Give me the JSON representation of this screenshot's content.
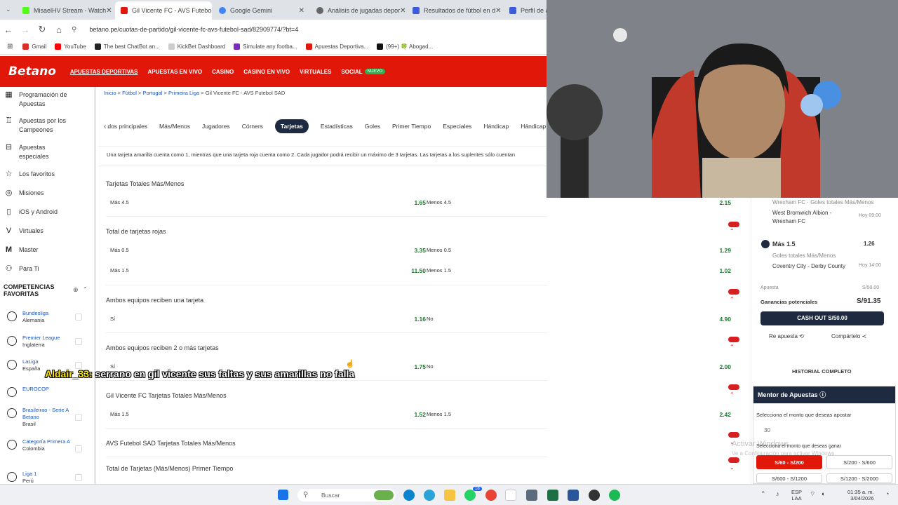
{
  "browser": {
    "tabs": [
      {
        "title": "MisaelHV Stream - Watch",
        "color": "#53fc18"
      },
      {
        "title": "Gil Vicente FC - AVS Futebol",
        "color": "#e1170a",
        "active": true
      },
      {
        "title": "Google Gemini",
        "color": "#4285f4"
      },
      {
        "title": "Análisis de jugadas depor",
        "color": "#666666"
      },
      {
        "title": "Resultados de fútbol en d",
        "color": "#3b5bdb"
      },
      {
        "title": "Perfil de a",
        "color": "#3b5bdb"
      }
    ],
    "url": "betano.pe/cuotas-de-partido/gil-vicente-fc-avs-futebol-sad/82909774/?bt=4",
    "bookmarks": [
      "Gmail",
      "YouTube",
      "The best ChatBot an...",
      "KickBet Dashboard",
      "Simulate any footba...",
      "Apuestas Deportiva...",
      "(99+) 🍀 Abogad..."
    ]
  },
  "header": {
    "logo": "Betano",
    "nav": [
      "APUESTAS DEPORTIVAS",
      "APUESTAS EN VIVO",
      "CASINO",
      "CASINO EN VIVO",
      "VIRTUALES",
      "SOCIAL"
    ],
    "social_badge": "NUEVO"
  },
  "sidebar": {
    "items": [
      {
        "label": "Programación de Apuestas",
        "icon": "calendar-icon"
      },
      {
        "label": "Apuestas por los Campeones",
        "icon": "trophy-icon"
      },
      {
        "label": "Apuestas especiales",
        "icon": "ticket-icon"
      },
      {
        "label": "Los favoritos",
        "icon": "star-icon"
      },
      {
        "label": "Misiones",
        "icon": "target-icon"
      },
      {
        "label": "iOS y Android",
        "icon": "phone-icon"
      },
      {
        "label": "Virtuales",
        "icon": "virtual-icon"
      },
      {
        "label": "Master",
        "icon": "master-icon"
      },
      {
        "label": "Para Ti",
        "icon": "user-icon"
      }
    ],
    "favorites_title": "COMPETENCIAS FAVORITAS",
    "competitions": [
      {
        "name": "Bundesliga",
        "country": "Alemania"
      },
      {
        "name": "Premier League",
        "country": "Inglaterra"
      },
      {
        "name": "LaLiga",
        "country": "España"
      },
      {
        "name": "EUROCOP",
        "country": ""
      },
      {
        "name": "Brasileirao - Serie A Betano",
        "country": "Brasil"
      },
      {
        "name": "Categoría Primera A",
        "country": "Colombia"
      },
      {
        "name": "Liga 1",
        "country": "Perú"
      }
    ]
  },
  "main": {
    "breadcrumbs": [
      "Inicio",
      "Fútbol",
      "Portugal",
      "Primeira Liga",
      "Gil Vicente FC - AVS Futebol SAD"
    ],
    "tabs": [
      "dos principales",
      "Más/Menos",
      "Jugadores",
      "Córners",
      "Tarjetas",
      "Estadísticas",
      "Goles",
      "Primer Tiempo",
      "Especiales",
      "Hándicap",
      "Hándicap Asiá"
    ],
    "active_tab": "Tarjetas",
    "info": "Una tarjeta amarilla cuenta como 1, mientras que una tarjeta roja cuenta como 2. Cada jugador podrá recibir un máximo de 3 tarjetas. Las tarjetas a los suplentes sólo cuentan",
    "markets": [
      {
        "title": "Tarjetas Totales Más/Menos",
        "rows": [
          {
            "l": "Más 4.5",
            "o": "1.65",
            "l2": "Menos 4.5",
            "o2": "2.15"
          }
        ]
      },
      {
        "title": "Total de tarjetas rojas",
        "rows": [
          {
            "l": "Más 0.5",
            "o": "3.35",
            "l2": "Menos 0.5",
            "o2": "1.29"
          },
          {
            "l": "Más 1.5",
            "o": "11.50",
            "l2": "Menos 1.5",
            "o2": "1.02"
          }
        ]
      },
      {
        "title": "Ambos equipos reciben una tarjeta",
        "rows": [
          {
            "l": "Sí",
            "o": "1.16",
            "l2": "No",
            "o2": "4.90"
          }
        ]
      },
      {
        "title": "Ambos equipos reciben 2 o más tarjetas",
        "rows": [
          {
            "l": "Sí",
            "o": "1.75",
            "l2": "No",
            "o2": "2.00"
          }
        ]
      },
      {
        "title": "Gil Vicente FC Tarjetas Totales Más/Menos",
        "rows": [
          {
            "l": "Más 1.5",
            "o": "1.52",
            "l2": "Menos 1.5",
            "o2": "2.42"
          }
        ]
      },
      {
        "title": "AVS Futebol SAD Tarjetas Totales Más/Menos",
        "rows": []
      },
      {
        "title": "Total de Tarjetas (Más/Menos) Primer Tiempo",
        "rows": []
      }
    ]
  },
  "betslip": {
    "sel1_market": "Wrexham FC · Goles totales Más/Menos",
    "sel1_match": "West Bromwich Albion - Wrexham FC",
    "sel1_time": "Hoy 09:00",
    "sel2_pick": "Más 1.5",
    "sel2_odds": "1.26",
    "sel2_market": "Goles totales Más/Menos",
    "sel2_match": "Coventry City - Derby County",
    "sel2_time": "Hoy 14:00",
    "stake_label": "Apuesta",
    "stake_value": "S/50.00",
    "potential_label": "Ganancias potenciales",
    "potential_value": "S/91.35",
    "cashout": "CASH OUT  S/50.00",
    "reuse": "Re apuesta",
    "share": "Compártelo",
    "history": "HISTORIAL COMPLETO",
    "mentor_title": "Mentor de Apuestas",
    "mentor_q1": "Selecciona el monto que deseas apostar",
    "mentor_amount": "30",
    "mentor_q2": "Selecciona el monto que deseas ganar",
    "ranges": [
      "S/60 - S/200",
      "S/200 - S/600",
      "S/600 - S/1200",
      "S/1200 - S/2000"
    ]
  },
  "chat": {
    "user": "Aldair_33:",
    "message": " serrano en gil vicente sus faltas y sus amarillas no falla"
  },
  "watermark": {
    "line1": "Activar Windows",
    "line2": "Ve a Configuración para activar Windows."
  },
  "taskbar": {
    "search": "Buscar",
    "lang1": "ESP",
    "lang2": "LAA",
    "time": "01:35 a. m.",
    "date": "3/04/2026",
    "badge": "18"
  }
}
